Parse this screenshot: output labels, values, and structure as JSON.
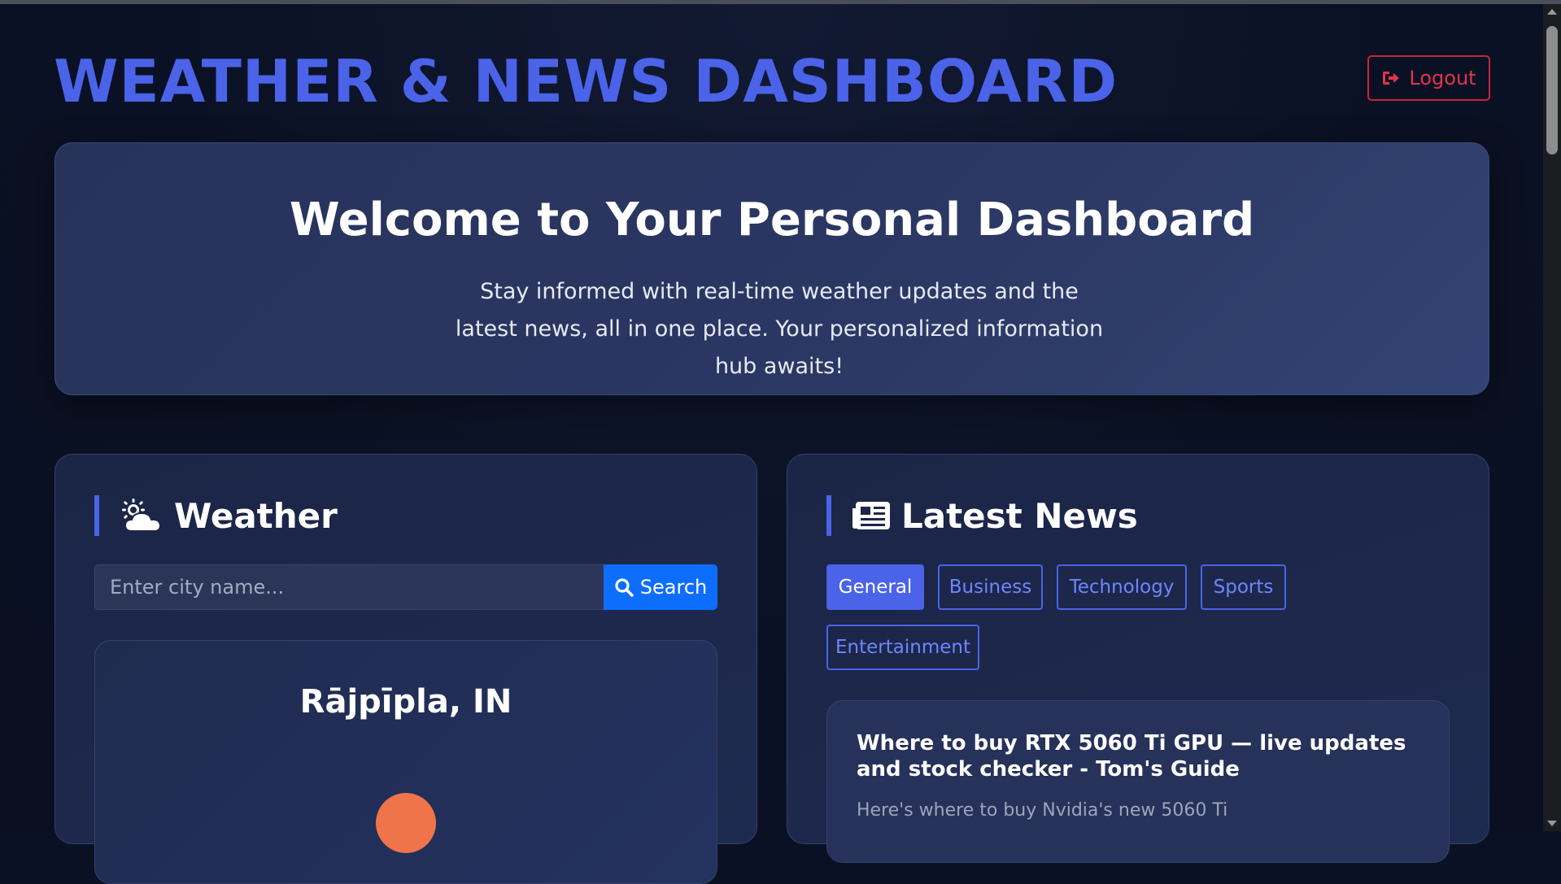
{
  "header": {
    "app_title": "WEATHER & NEWS DASHBOARD",
    "logout_label": "Logout"
  },
  "hero": {
    "title": "Welcome to Your Personal Dashboard",
    "subtitle": "Stay informed with real-time weather updates and the latest news, all in one place. Your personalized information hub awaits!"
  },
  "weather": {
    "title": "Weather",
    "search_placeholder": "Enter city name...",
    "search_value": "",
    "search_button": "Search",
    "city": "Rājpīpla, IN",
    "icon": "sun-icon"
  },
  "news": {
    "title": "Latest News",
    "tabs": [
      {
        "label": "General",
        "active": true
      },
      {
        "label": "Business",
        "active": false
      },
      {
        "label": "Technology",
        "active": false
      },
      {
        "label": "Sports",
        "active": false
      },
      {
        "label": "Entertainment",
        "active": false
      }
    ],
    "articles": [
      {
        "title": "Where to buy RTX 5060 Ti GPU — live updates and stock checker - Tom's Guide",
        "description": "Here's where to buy Nvidia's new 5060 Ti"
      }
    ]
  },
  "colors": {
    "accent": "#4a63e8",
    "danger": "#dc3545",
    "primary_button": "#0d6efd",
    "background": "#0b1124"
  }
}
